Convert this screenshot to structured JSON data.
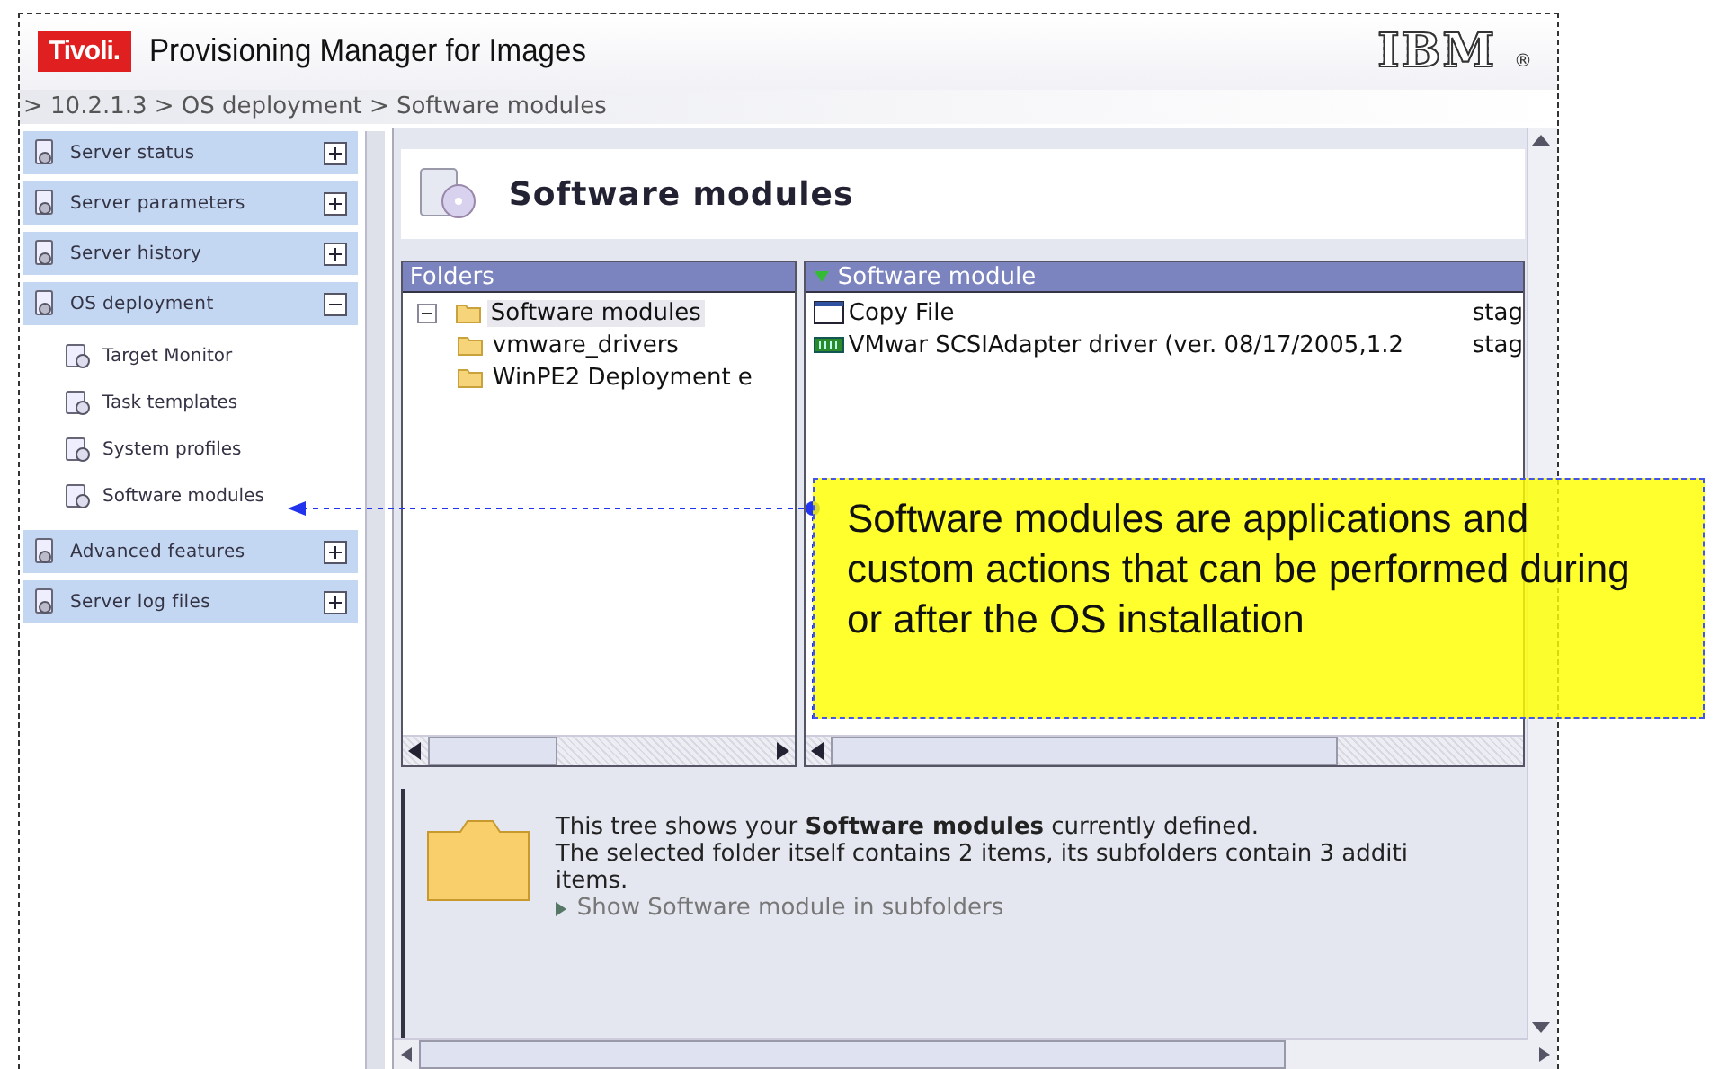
{
  "header": {
    "logo": "Tivoli.",
    "title": "Provisioning Manager for Images",
    "brand": "IBM",
    "brand_mark": "®"
  },
  "breadcrumb": "> 10.2.1.3 > OS deployment > Software modules",
  "sidebar": {
    "sections": [
      {
        "label": "Server status",
        "expanded": false
      },
      {
        "label": "Server parameters",
        "expanded": false
      },
      {
        "label": "Server history",
        "expanded": false
      },
      {
        "label": "OS deployment",
        "expanded": true,
        "children": [
          "Target Monitor",
          "Task templates",
          "System profiles",
          "Software modules"
        ]
      },
      {
        "label": "Advanced features",
        "expanded": false
      },
      {
        "label": "Server log files",
        "expanded": false
      }
    ]
  },
  "page_title": "Software modules",
  "folders": {
    "title": "Folders",
    "tree": [
      {
        "label": "Software modules",
        "expanded": true,
        "selected": true,
        "children": [
          {
            "label": "vmware_drivers",
            "selected": false
          },
          {
            "label": "WinPE2 Deployment e",
            "selected": false
          }
        ]
      }
    ]
  },
  "modules": {
    "column_1": "Software module",
    "rows": [
      {
        "kind": "window",
        "name": "Copy File",
        "column_2": "stag"
      },
      {
        "kind": "chip",
        "name": "VMwar SCSIAdapter driver (ver. 08/17/2005,1.2",
        "column_2": "stag"
      }
    ]
  },
  "info": {
    "lines": [
      "This tree shows your **Software modules** currently defined.",
      "The selected folder itself contains 2 items, its subfolders contain 3 additi",
      "items."
    ],
    "link": "Show Software module in subfolders"
  },
  "callout": {
    "text": "Software modules are applications and custom actions that can be performed during or after the OS installation"
  }
}
